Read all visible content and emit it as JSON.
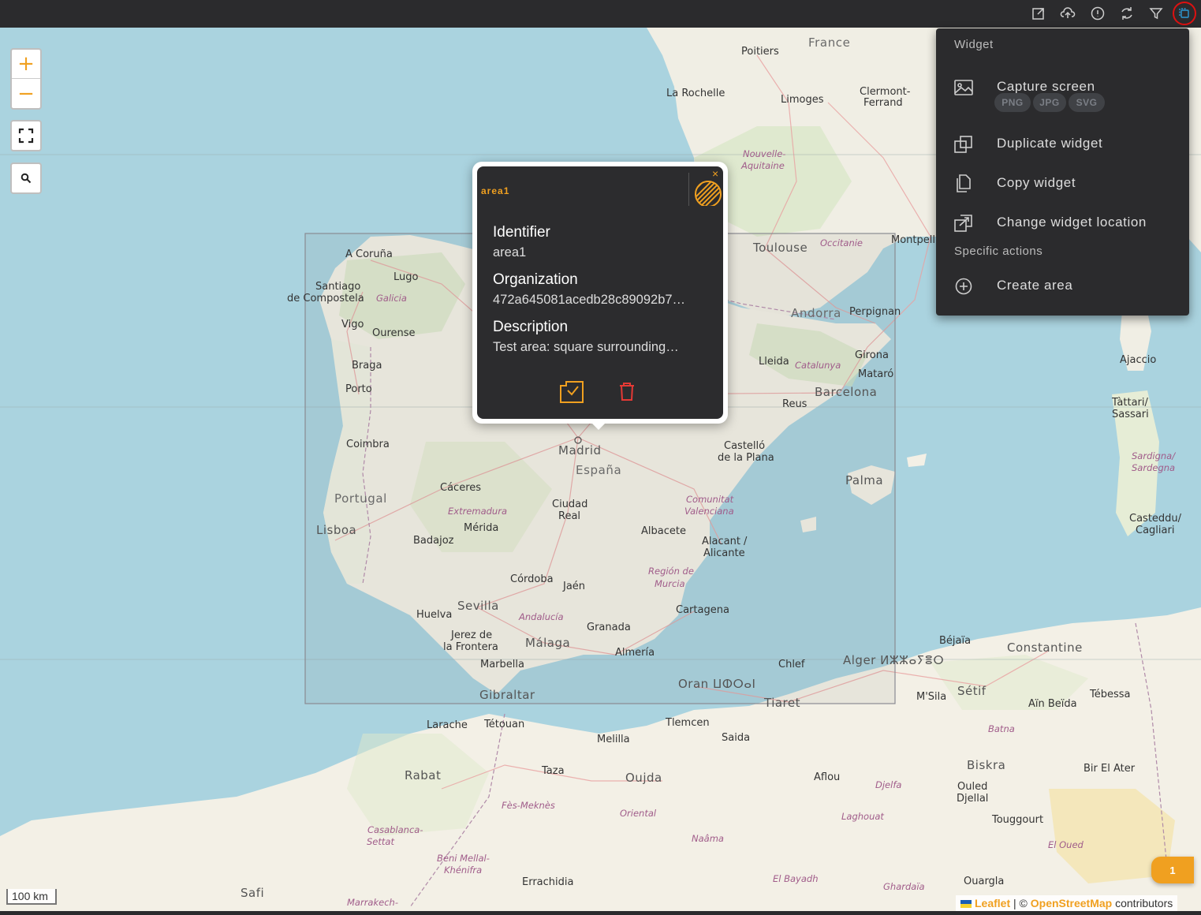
{
  "topbar": {
    "icons": [
      "export-icon",
      "upload-icon",
      "info-icon",
      "refresh-icon",
      "filter-icon",
      "widget-menu-icon"
    ]
  },
  "map": {
    "controls": {
      "zoom_in": "+",
      "zoom_out": "−"
    },
    "scale": "100 km",
    "attribution": {
      "leaflet": "Leaflet",
      "separator": " | © ",
      "osm": "OpenStreetMap",
      "contributors": " contributors"
    },
    "badge": "1",
    "labels": {
      "france": "France",
      "poitiers": "Poitiers",
      "la_rochelle": "La Rochelle",
      "limoges": "Limoges",
      "clermont1": "Clermont-",
      "clermont2": "Ferrand",
      "nouvelle1": "Nouvelle-",
      "nouvelle2": "Aquitaine",
      "toulouse": "Toulouse",
      "occitanie": "Occitanie",
      "montpellier": "Montpelli",
      "andorra": "Andorra",
      "perpignan": "Perpignan",
      "girona": "Girona",
      "lleida": "Lleida",
      "catalunya": "Catalunya",
      "mataro": "Mataró",
      "barcelona": "Barcelona",
      "reus": "Reus",
      "ajaccio": "Ajaccio",
      "tattari1": "Tàttari/",
      "tattari2": "Sassari",
      "sardigna1": "Sardigna/",
      "sardigna2": "Sardegna",
      "casteddu1": "Casteddu/",
      "casteddu2": "Cagliari",
      "acoruna": "A Coruña",
      "lugo": "Lugo",
      "santiago1": "Santiago",
      "santiago2": "de Compostela",
      "galicia": "Galicia",
      "vigo": "Vigo",
      "ourense": "Ourense",
      "braga": "Braga",
      "porto": "Porto",
      "coimbra": "Coimbra",
      "portugal": "Portugal",
      "lisboa": "Lisboa",
      "caceres": "Cáceres",
      "extremadura": "Extremadura",
      "merida": "Mérida",
      "badajoz": "Badajoz",
      "madrid": "Madrid",
      "espana": "España",
      "ciudad1": "Ciudad",
      "ciudad2": "Real",
      "castello1": "Castelló",
      "castello2": "de la Plana",
      "comunitat1": "Comunitat",
      "comunitat2": "Valenciana",
      "palma": "Palma",
      "albacete": "Albacete",
      "alacant1": "Alacant /",
      "alacant2": "Alicante",
      "murcia1": "Región de",
      "murcia2": "Murcia",
      "cartagena": "Cartagena",
      "cordoba": "Córdoba",
      "jaen": "Jaén",
      "sevilla": "Sevilla",
      "huelva": "Huelva",
      "andalucia": "Andalucía",
      "granada": "Granada",
      "jerez1": "Jerez de",
      "jerez2": "la Frontera",
      "malaga": "Málaga",
      "almeria": "Almería",
      "marbella": "Marbella",
      "gibraltar": "Gibraltar",
      "larache": "Larache",
      "tetouan": "Tétouan",
      "melilla": "Melilla",
      "tlemcen": "Tlemcen",
      "oran": "Oran ⵡⵀⵔⴰⵏ",
      "chlef": "Chlef",
      "alger": "Alger ⵍⵣⵣⴰⵢⴻⵔ",
      "tiaret": "Tiaret",
      "saida": "Saida",
      "taza": "Taza",
      "oujda": "Oujda",
      "rabat": "Rabat",
      "fes": "Fès-Meknès",
      "oriental": "Oriental",
      "naama": "Naâma",
      "aflou": "Aflou",
      "djelfa": "Djelfa",
      "laghouat": "Laghouat",
      "bejaia": "Béjaïa",
      "constantine": "Constantine",
      "setif": "Sétif",
      "msila": "M'Sila",
      "batna": "Batna",
      "biskra": "Biskra",
      "tebessa": "Tébessa",
      "ain_beida": "Aïn Beïda",
      "ouled1": "Ouled",
      "ouled2": "Djellal",
      "bir": "Bir El Ater",
      "touggourt": "Touggourt",
      "el_oued": "El Oued",
      "ouargla": "Ouargla",
      "ghardaia": "Ghardaïa",
      "el_bayadh": "El Bayadh",
      "errachidia": "Errachidia",
      "beni1": "Béni Mellal-",
      "beni2": "Khénifra",
      "casa1": "Casablanca-",
      "casa2": "Settat",
      "safi": "Safi",
      "marrakech": "Marrakech-"
    }
  },
  "popup": {
    "title": "area1",
    "fields": [
      {
        "label": "Identifier",
        "value": "area1"
      },
      {
        "label": "Organization",
        "value": "472a645081acedb28c89092b7…"
      },
      {
        "label": "Description",
        "value": "Test area: square surrounding…"
      }
    ],
    "close": "×"
  },
  "menu": {
    "section_widget": "Widget",
    "capture": "Capture screen",
    "formats": [
      "PNG",
      "JPG",
      "SVG"
    ],
    "duplicate": "Duplicate widget",
    "copy": "Copy widget",
    "change_location": "Change widget location",
    "section_specific": "Specific actions",
    "create_area": "Create area"
  }
}
